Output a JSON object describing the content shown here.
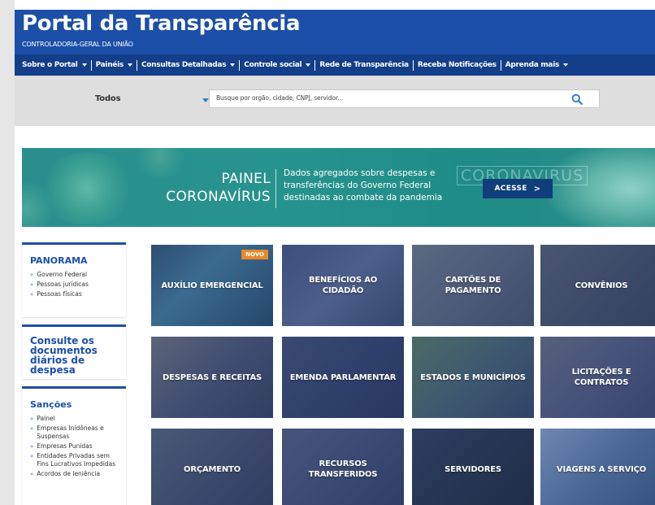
{
  "header": {
    "title": "Portal da Transparência",
    "subtitle": "CONTROLADORIA-GERAL DA UNIÃO"
  },
  "nav": {
    "items": [
      {
        "label": "Sobre o Portal",
        "dropdown": true
      },
      {
        "label": "Painéis",
        "dropdown": true
      },
      {
        "label": "Consultas Detalhadas",
        "dropdown": true
      },
      {
        "label": "Controle social",
        "dropdown": true
      },
      {
        "label": "Rede de Transparência",
        "dropdown": false
      },
      {
        "label": "Receba Notificações",
        "dropdown": false
      },
      {
        "label": "Aprenda mais",
        "dropdown": true
      }
    ]
  },
  "search": {
    "scope_value": "Todos",
    "placeholder": "Busque por orgão, cidade, CNPJ, servidor..."
  },
  "banner": {
    "line1": "PAINEL",
    "line2": "CORONAVÍRUS",
    "description": "Dados agregados sobre despesas e transferências do Governo Federal destinadas ao combate da pandemia",
    "stamp": "CORONAVIRUS",
    "button_label": "ACESSE",
    "button_chevron": ">"
  },
  "sidebar": {
    "panorama": {
      "title": "PANORAMA",
      "links": [
        "Governo Federal",
        "Pessoas jurídicas",
        "Pessoas físicas"
      ]
    },
    "consulte": {
      "title": "Consulte os documentos diários de despesa"
    },
    "sancoes": {
      "title": "Sanções",
      "links": [
        "Painel",
        "Empresas Inidôneas e Suspensas",
        "Empresas Punidas",
        "Entidades Privadas sem Fins Lucrativos Impedidas",
        "Acordos de leniência"
      ]
    }
  },
  "tiles": [
    {
      "label": "AUXÍLIO EMERGENCIAL",
      "badge": "NOVO"
    },
    {
      "label": "BENEFÍCIOS AO CIDADÃO"
    },
    {
      "label": "CARTÕES DE PAGAMENTO"
    },
    {
      "label": "CONVÊNIOS"
    },
    {
      "label": "DESPESAS E RECEITAS"
    },
    {
      "label": "EMENDA PARLAMENTAR"
    },
    {
      "label": "ESTADOS E MUNICÍPIOS"
    },
    {
      "label": "LICITAÇÕES E CONTRATOS"
    },
    {
      "label": "ORÇAMENTO"
    },
    {
      "label": "RECURSOS TRANSFERIDOS"
    },
    {
      "label": "SERVIDORES"
    },
    {
      "label": "VIAGENS A SERVIÇO"
    }
  ],
  "colors": {
    "header_blue": "#1b4fa8",
    "nav_blue": "#123e8a",
    "banner_teal": "#27938f",
    "accent_blue": "#2b7fd4",
    "badge_orange": "#e8892b"
  }
}
